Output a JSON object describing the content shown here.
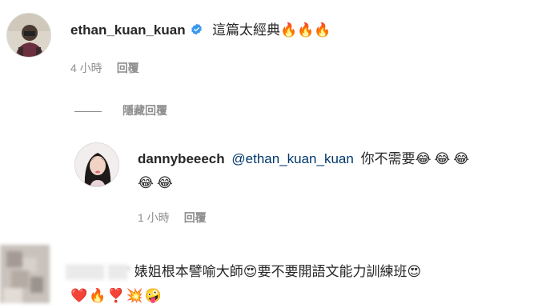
{
  "comment1": {
    "username": "ethan_kuan_kuan",
    "text": "這篇太經典",
    "emojis": "🔥🔥🔥",
    "time": "4 小時",
    "reply_label": "回覆",
    "verified_icon": "verified-badge-icon"
  },
  "hide_replies": {
    "label": "隱藏回覆"
  },
  "reply1": {
    "username": "dannybeeech",
    "mention": "@ethan_kuan_kuan",
    "text": "你不需要",
    "emojis_line1": "😂😂😂",
    "emojis_line2": "😂😂",
    "time": "1 小時",
    "reply_label": "回覆"
  },
  "comment2": {
    "username_blurred": "▒▒▒▒ ▒▒' ",
    "text_part1": "婊姐根本譬喻大師",
    "emoji1": "😍",
    "text_part2": "要不要開語文能力訓練班",
    "emoji2": "😍",
    "emojis_line2": "❤️🔥❣️💥🤪"
  },
  "colors": {
    "verified": "#3897f0",
    "mention": "#00376b",
    "meta": "#8e8e8e"
  }
}
